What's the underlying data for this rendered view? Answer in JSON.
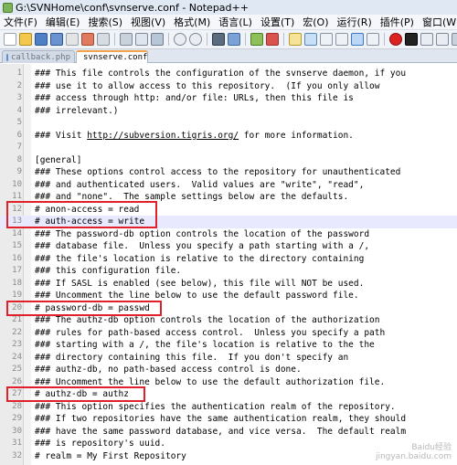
{
  "window": {
    "title": "G:\\SVNHome\\conf\\svnserve.conf - Notepad++"
  },
  "menu": [
    "文件(F)",
    "编辑(E)",
    "搜索(S)",
    "视图(V)",
    "格式(M)",
    "语言(L)",
    "设置(T)",
    "宏(O)",
    "运行(R)",
    "插件(P)",
    "窗口(W)",
    "?"
  ],
  "tabs": [
    {
      "label": "callback.php",
      "active": false
    },
    {
      "label": "svnserve.conf",
      "active": true
    }
  ],
  "editor": {
    "current_line": 13,
    "lines": [
      {
        "n": "1",
        "text": "### This file controls the configuration of the svnserve daemon, if you"
      },
      {
        "n": "2",
        "text": "### use it to allow access to this repository.  (If you only allow"
      },
      {
        "n": "3",
        "text": "### access through http: and/or file: URLs, then this file is"
      },
      {
        "n": "4",
        "text": "### irrelevant.)"
      },
      {
        "n": "5",
        "text": ""
      },
      {
        "n": "6",
        "text": "### Visit ",
        "link": "http://subversion.tigris.org/",
        "after": " for more information."
      },
      {
        "n": "7",
        "text": ""
      },
      {
        "n": "8",
        "text": "[general]"
      },
      {
        "n": "9",
        "text": "### These options control access to the repository for unauthenticated"
      },
      {
        "n": "10",
        "text": "### and authenticated users.  Valid values are \"write\", \"read\","
      },
      {
        "n": "11",
        "text": "### and \"none\".  The sample settings below are the defaults."
      },
      {
        "n": "12",
        "text": "# anon-access = read"
      },
      {
        "n": "13",
        "text": "# auth-access = write"
      },
      {
        "n": "14",
        "text": "### The password-db option controls the location of the password"
      },
      {
        "n": "15",
        "text": "### database file.  Unless you specify a path starting with a /,"
      },
      {
        "n": "16",
        "text": "### the file's location is relative to the directory containing"
      },
      {
        "n": "17",
        "text": "### this configuration file."
      },
      {
        "n": "18",
        "text": "### If SASL is enabled (see below), this file will NOT be used."
      },
      {
        "n": "19",
        "text": "### Uncomment the line below to use the default password file."
      },
      {
        "n": "20",
        "text": "# password-db = passwd"
      },
      {
        "n": "21",
        "text": "### The authz-db option controls the location of the authorization"
      },
      {
        "n": "22",
        "text": "### rules for path-based access control.  Unless you specify a path"
      },
      {
        "n": "23",
        "text": "### starting with a /, the file's location is relative to the the"
      },
      {
        "n": "24",
        "text": "### directory containing this file.  If you don't specify an"
      },
      {
        "n": "25",
        "text": "### authz-db, no path-based access control is done."
      },
      {
        "n": "26",
        "text": "### Uncomment the line below to use the default authorization file."
      },
      {
        "n": "27",
        "text": "# authz-db = authz"
      },
      {
        "n": "28",
        "text": "### This option specifies the authentication realm of the repository."
      },
      {
        "n": "29",
        "text": "### If two repositories have the same authentication realm, they should"
      },
      {
        "n": "30",
        "text": "### have the same password database, and vice versa.  The default realm"
      },
      {
        "n": "31",
        "text": "### is repository's uuid."
      },
      {
        "n": "32",
        "text": "# realm = My First Repository"
      }
    ]
  },
  "annotations": {
    "highlight_color": "#e0202a"
  },
  "watermark": {
    "line1": "Baidu经验",
    "line2": "jingyan.baidu.com"
  },
  "icons": [
    "new-file-icon",
    "open-icon",
    "save-icon",
    "save-all-icon",
    "close-icon",
    "close-all-icon",
    "print-icon",
    "cut-icon",
    "copy-icon",
    "paste-icon",
    "undo-icon",
    "redo-icon",
    "find-icon",
    "replace-icon",
    "zoom-in-icon",
    "zoom-out-icon",
    "sync-v-icon",
    "sync-h-icon",
    "wrap-icon",
    "all-chars-icon",
    "indent-guide-icon",
    "doc-map-icon",
    "record-icon",
    "stop-icon",
    "play-icon",
    "play-multi-icon",
    "save-macro-icon"
  ]
}
